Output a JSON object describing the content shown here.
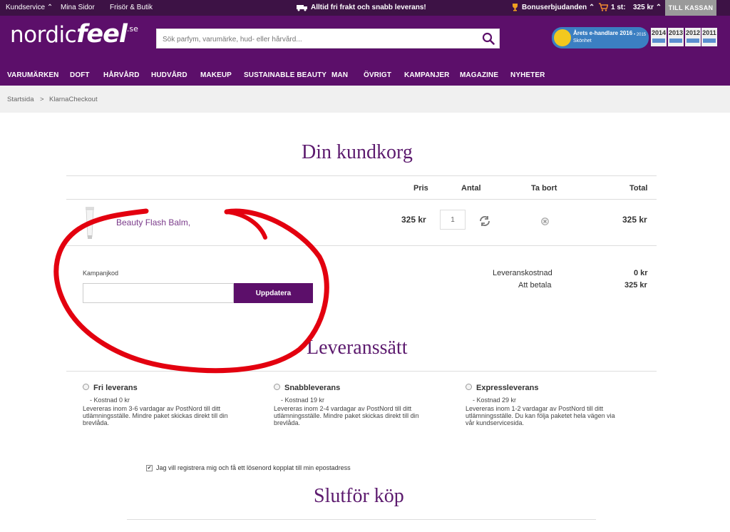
{
  "topbar": {
    "kundservice": "Kundservice",
    "mina_sidor": "Mina Sidor",
    "frisor": "Frisör & Butik",
    "frakt": "Alltid fri frakt och snabb leverans!",
    "bonus": "Bonuserbjudanden",
    "cart_count": "1 st:",
    "cart_total": "325 kr",
    "kassan": "TILL KASSAN"
  },
  "header": {
    "logo_nordic": "nordic",
    "logo_feel": "feel",
    "logo_se": ".se",
    "search_placeholder": "Sök parfym, varumärke, hud- eller hårvård...",
    "badge_title": "Årets e-handlare 2016",
    "badge_sub": "Skönhet",
    "badge_year": "• 2015",
    "years": [
      "2014",
      "2013",
      "2012",
      "2011"
    ]
  },
  "nav": [
    "VARUMÄRKEN",
    "DOFT",
    "HÅRVÅRD",
    "HUDVÅRD",
    "MAKEUP",
    "SUSTAINABLE BEAUTY",
    "MAN",
    "ÖVRIGT",
    "KAMPANJER",
    "MAGAZINE",
    "NYHETER"
  ],
  "breadcrumb": {
    "home": "Startsida",
    "sep": ">",
    "current": "KlarnaCheckout"
  },
  "cart": {
    "title": "Din kundkorg",
    "col_pris": "Pris",
    "col_antal": "Antal",
    "col_ta_bort": "Ta bort",
    "col_total": "Total",
    "product": "Beauty Flash Balm,",
    "price": "325 kr",
    "qty": "1",
    "total": "325 kr",
    "kampanj_label": "Kampanjkod",
    "update_label": "Uppdatera",
    "leverans_label": "Leveranskostnad",
    "leverans_value": "0 kr",
    "betala_label": "Att betala",
    "betala_value": "325 kr"
  },
  "delivery": {
    "title": "Leveranssätt",
    "options": [
      {
        "name": "Fri leverans",
        "cost": "- Kostnad 0 kr",
        "desc": "Levereras inom 3-6 vardagar av PostNord till ditt utlämningsställe. Mindre paket skickas direkt till din brevlåda."
      },
      {
        "name": "Snabbleverans",
        "cost": "- Kostnad 19 kr",
        "desc": "Levereras inom 2-4 vardagar av PostNord till ditt utlämningsställe. Mindre paket skickas direkt till din brevlåda."
      },
      {
        "name": "Expressleverans",
        "cost": "- Kostnad 29 kr",
        "desc": "Levereras inom 1-2 vardagar av PostNord till ditt utlämningsställe. Du kan följa paketet hela vägen via vår kundservicesida."
      }
    ]
  },
  "register": {
    "label": "Jag vill registrera mig och få ett lösenord kopplat till min epostadress",
    "mark": "✔"
  },
  "checkout": {
    "title": "Slutför köp"
  },
  "colors": {
    "brand": "#5c0f6a",
    "topbar": "#3d1245",
    "annotation": "#e3000f"
  }
}
